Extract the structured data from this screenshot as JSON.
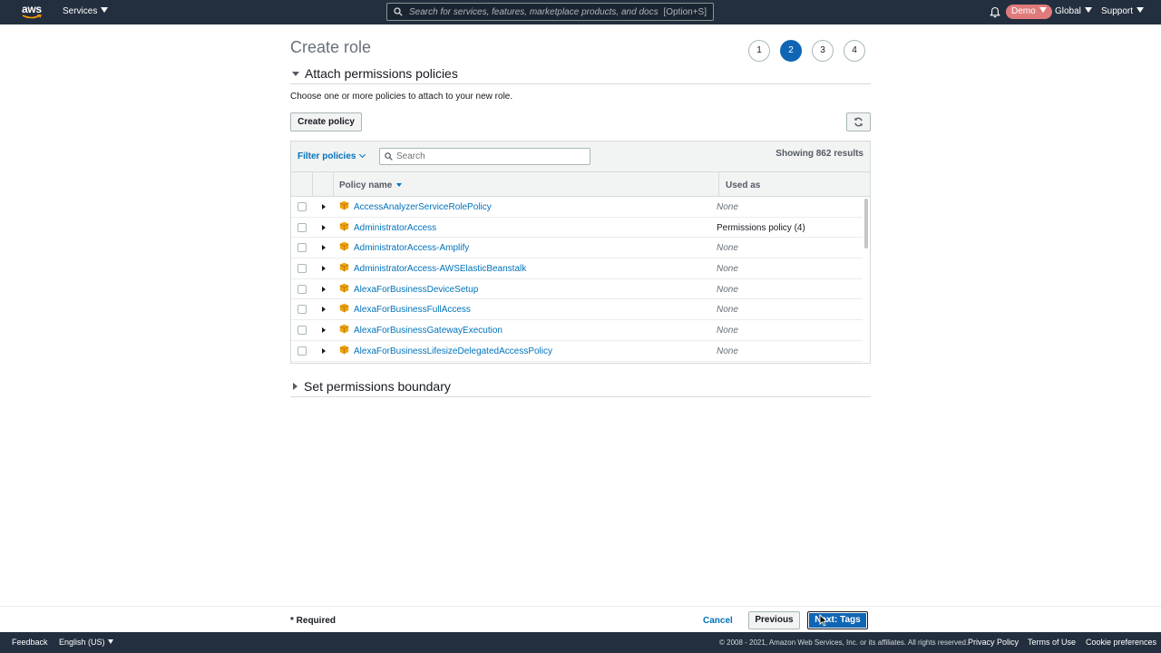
{
  "topnav": {
    "logo_text": "aws",
    "services_label": "Services",
    "search_placeholder": "Search for services, features, marketplace products, and docs",
    "search_shortcut": "[Option+S]",
    "account_label": "Demo",
    "region_label": "Global",
    "support_label": "Support"
  },
  "page": {
    "title": "Create role",
    "steps": [
      "1",
      "2",
      "3",
      "4"
    ],
    "active_step": "2"
  },
  "attach_section": {
    "heading": "Attach permissions policies",
    "description": "Choose one or more policies to attach to your new role.",
    "create_policy_label": "Create policy"
  },
  "filter": {
    "filter_label": "Filter policies",
    "search_placeholder": "Search",
    "results_text": "Showing 862 results"
  },
  "table": {
    "columns": [
      "Policy name",
      "Used as"
    ],
    "rows": [
      {
        "name": "AccessAnalyzerServiceRolePolicy",
        "used_as": "None"
      },
      {
        "name": "AdministratorAccess",
        "used_as": "Permissions policy (4)"
      },
      {
        "name": "AdministratorAccess-Amplify",
        "used_as": "None"
      },
      {
        "name": "AdministratorAccess-AWSElasticBeanstalk",
        "used_as": "None"
      },
      {
        "name": "AlexaForBusinessDeviceSetup",
        "used_as": "None"
      },
      {
        "name": "AlexaForBusinessFullAccess",
        "used_as": "None"
      },
      {
        "name": "AlexaForBusinessGatewayExecution",
        "used_as": "None"
      },
      {
        "name": "AlexaForBusinessLifesizeDelegatedAccessPolicy",
        "used_as": "None"
      }
    ]
  },
  "boundary_section": {
    "heading": "Set permissions boundary"
  },
  "actions": {
    "required_label": "* Required",
    "cancel_label": "Cancel",
    "previous_label": "Previous",
    "next_label": "Next: Tags"
  },
  "footer": {
    "feedback_label": "Feedback",
    "language_label": "English (US)",
    "copyright": "© 2008 - 2021, Amazon Web Services, Inc. or its affiliates. All rights reserved.",
    "privacy_label": "Privacy Policy",
    "terms_label": "Terms of Use",
    "cookie_label": "Cookie preferences"
  },
  "colors": {
    "nav_bg": "#232f3e",
    "link_blue": "#0073bb",
    "primary_button": "#1066b4",
    "policy_icon": "#f0a30a"
  },
  "icons": [
    "aws-logo",
    "caret-down-icon",
    "search-icon",
    "bell-icon",
    "refresh-icon",
    "policy-cube-icon",
    "expand-row-icon",
    "sort-caret-icon"
  ]
}
